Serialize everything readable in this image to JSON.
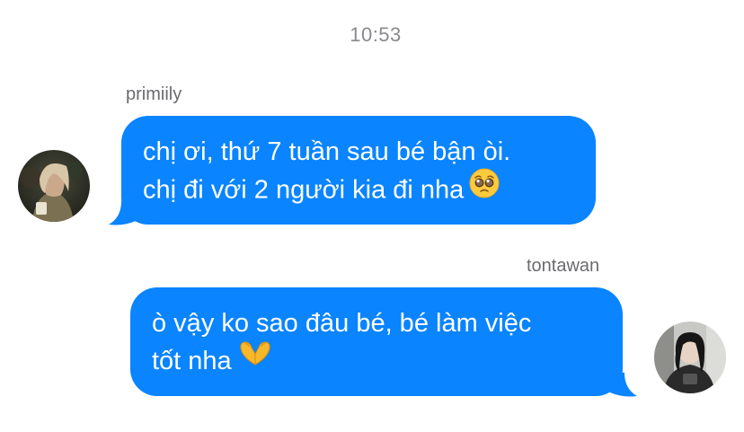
{
  "thread": {
    "timestamp": "10:53"
  },
  "messages": [
    {
      "sender": "primiily",
      "side": "left",
      "lines": [
        "chị ơi, thứ 7 tuần sau bé bận òi.",
        "chị đi với 2 người kia đi nha"
      ],
      "emoji": "pleading-face-emoji",
      "avatar": "avatar-primiily"
    },
    {
      "sender": "tontawan",
      "side": "right",
      "lines": [
        "ò vậy ko sao đâu bé, bé làm việc",
        "tốt nha"
      ],
      "emoji": "heart-hands-emoji",
      "avatar": "avatar-tontawan"
    }
  ],
  "colors": {
    "bubble": "#0a84ff",
    "bubble_text": "#ffffff",
    "timestamp": "#8a8a8e",
    "sender_name": "#6b6b6f",
    "background": "#ffffff"
  }
}
